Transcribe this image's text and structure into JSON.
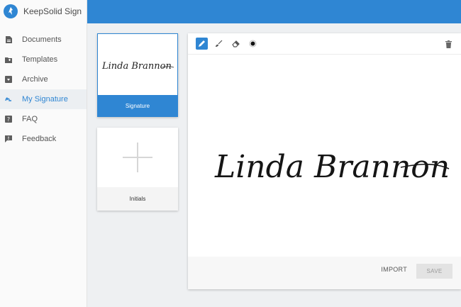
{
  "app": {
    "name": "KeepSolid Sign",
    "brand_color": "#2f86d3"
  },
  "sidebar": {
    "items": [
      {
        "label": "Documents",
        "icon": "document-icon",
        "active": false
      },
      {
        "label": "Templates",
        "icon": "template-folder-icon",
        "active": false
      },
      {
        "label": "Archive",
        "icon": "archive-icon",
        "active": false
      },
      {
        "label": "My Signature",
        "icon": "signature-icon",
        "active": true
      },
      {
        "label": "FAQ",
        "icon": "help-icon",
        "active": false
      },
      {
        "label": "Feedback",
        "icon": "feedback-icon",
        "active": false
      }
    ]
  },
  "signature_cards": {
    "signature": {
      "label": "Signature",
      "name": "Linda Brannon"
    },
    "initials": {
      "label": "Initials"
    }
  },
  "editor": {
    "tools": [
      "pen-icon",
      "brush-icon",
      "eraser-icon",
      "color-dot-icon"
    ],
    "delete_icon": "trash-icon",
    "signature_text": "Linda Brannon",
    "import_label": "IMPORT",
    "save_label": "SAVE"
  }
}
